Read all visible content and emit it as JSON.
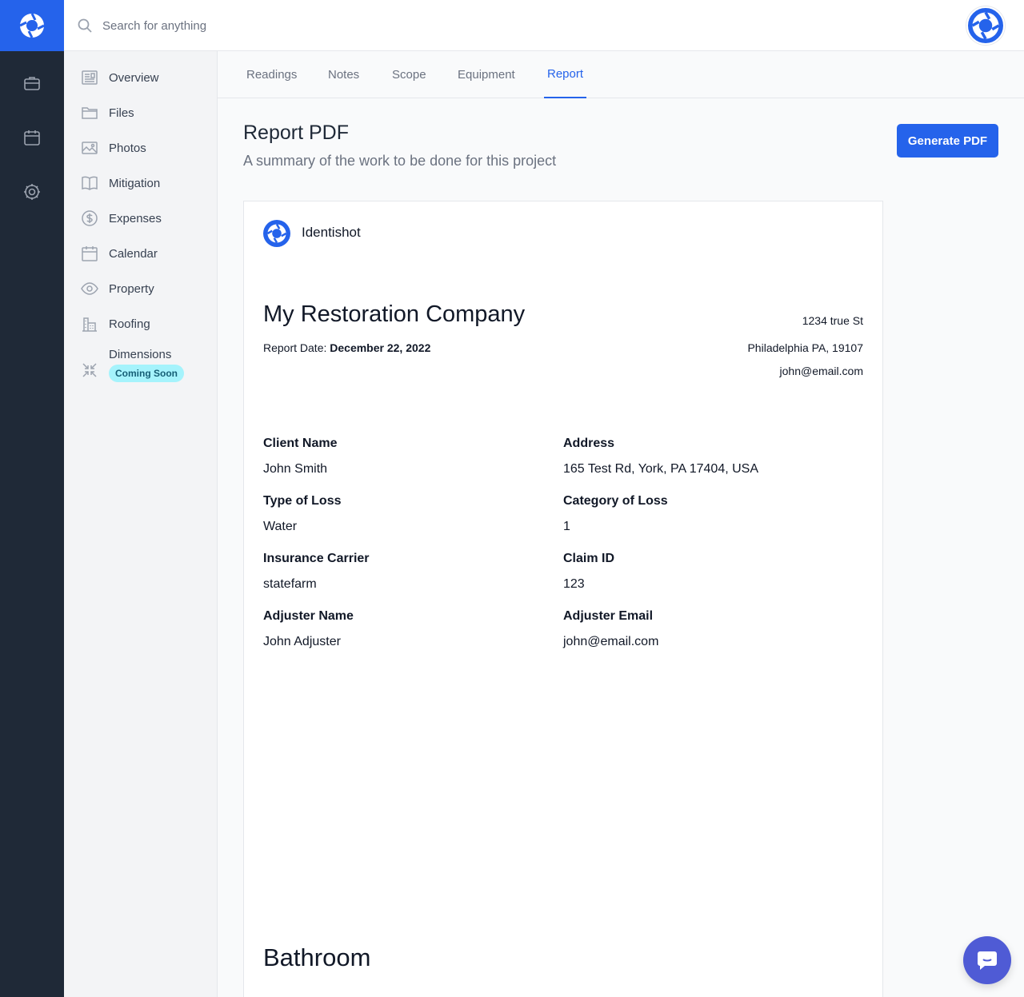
{
  "app": {
    "brand_color": "#2563eb",
    "rail_color": "#1f2937"
  },
  "search": {
    "placeholder": "Search for anything"
  },
  "rail": {
    "items": [
      {
        "icon": "briefcase-icon"
      },
      {
        "icon": "calendar-icon"
      },
      {
        "icon": "settings-gear-icon"
      }
    ]
  },
  "sidebar": {
    "items": [
      {
        "label": "Overview",
        "icon": "newspaper-icon"
      },
      {
        "label": "Files",
        "icon": "folder-icon"
      },
      {
        "label": "Photos",
        "icon": "image-icon"
      },
      {
        "label": "Mitigation",
        "icon": "book-open-icon"
      },
      {
        "label": "Expenses",
        "icon": "dollar-circle-icon"
      },
      {
        "label": "Calendar",
        "icon": "calendar-icon"
      },
      {
        "label": "Property",
        "icon": "eye-icon"
      },
      {
        "label": "Roofing",
        "icon": "building-icon"
      },
      {
        "label": "Dimensions",
        "icon": "arrows-collapse-icon",
        "badge": "Coming Soon"
      }
    ]
  },
  "tabs": [
    {
      "label": "Readings",
      "active": false
    },
    {
      "label": "Notes",
      "active": false
    },
    {
      "label": "Scope",
      "active": false
    },
    {
      "label": "Equipment",
      "active": false
    },
    {
      "label": "Report",
      "active": true
    }
  ],
  "page": {
    "title": "Report PDF",
    "subtitle": "A summary of the work to be done for this project",
    "generate_button": "Generate PDF"
  },
  "report": {
    "brand_name": "Identishot",
    "company_name": "My Restoration Company",
    "report_date_label": "Report Date:",
    "report_date": "December 22, 2022",
    "address_lines": [
      "1234 true St",
      "Philadelphia PA, 19107",
      "john@email.com"
    ],
    "fields": [
      {
        "label": "Client Name",
        "value": "John Smith"
      },
      {
        "label": "Address",
        "value": "165 Test Rd, York, PA 17404, USA"
      },
      {
        "label": "Type of Loss",
        "value": "Water"
      },
      {
        "label": "Category of Loss",
        "value": "1"
      },
      {
        "label": "Insurance Carrier",
        "value": "statefarm"
      },
      {
        "label": "Claim ID",
        "value": "123"
      },
      {
        "label": "Adjuster Name",
        "value": "John Adjuster"
      },
      {
        "label": "Adjuster Email",
        "value": "john@email.com"
      }
    ],
    "section_title": "Bathroom"
  }
}
